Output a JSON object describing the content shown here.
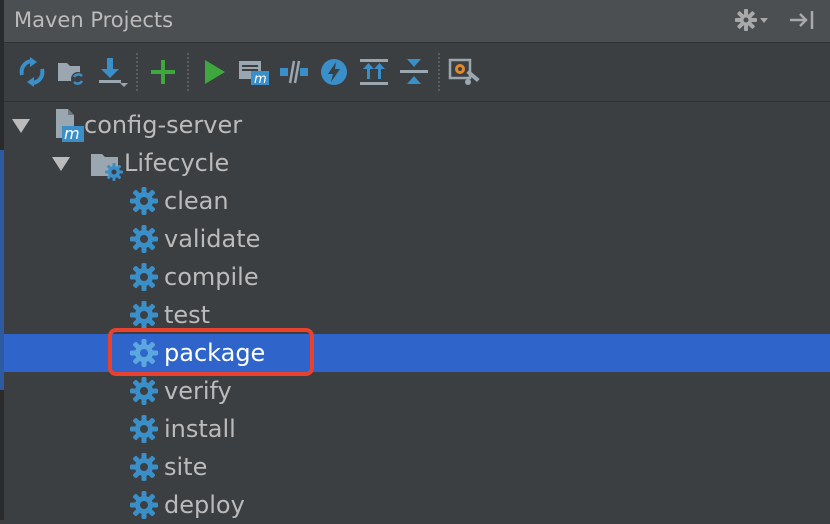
{
  "panel": {
    "title": "Maven Projects",
    "settings_icon": "gear-icon",
    "hide_icon": "hide-panel-icon"
  },
  "toolbar": {
    "buttons": [
      {
        "name": "reimport",
        "icon": "refresh-icon"
      },
      {
        "name": "generate-sources",
        "icon": "folder-refresh-icon"
      },
      {
        "name": "download",
        "icon": "download-icon"
      },
      {
        "name": "add",
        "icon": "plus-icon"
      },
      {
        "name": "run",
        "icon": "play-icon"
      },
      {
        "name": "execute-goal",
        "icon": "maven-goal-icon"
      },
      {
        "name": "toggle-offline",
        "icon": "offline-icon"
      },
      {
        "name": "skip-tests",
        "icon": "lightning-icon"
      },
      {
        "name": "show-dependencies",
        "icon": "dependencies-icon"
      },
      {
        "name": "collapse-all",
        "icon": "collapse-icon"
      },
      {
        "name": "settings",
        "icon": "maven-settings-icon"
      }
    ]
  },
  "tree": {
    "project": "config-server",
    "lifecycle_label": "Lifecycle",
    "goals": [
      "clean",
      "validate",
      "compile",
      "test",
      "package",
      "verify",
      "install",
      "site",
      "deploy"
    ],
    "selected_goal": "package"
  },
  "colors": {
    "background": "#3c3f41",
    "selection": "#2f65ca",
    "gear": "#3a8fc9",
    "run_green": "#3ea83e",
    "highlight": "#e8412e"
  }
}
